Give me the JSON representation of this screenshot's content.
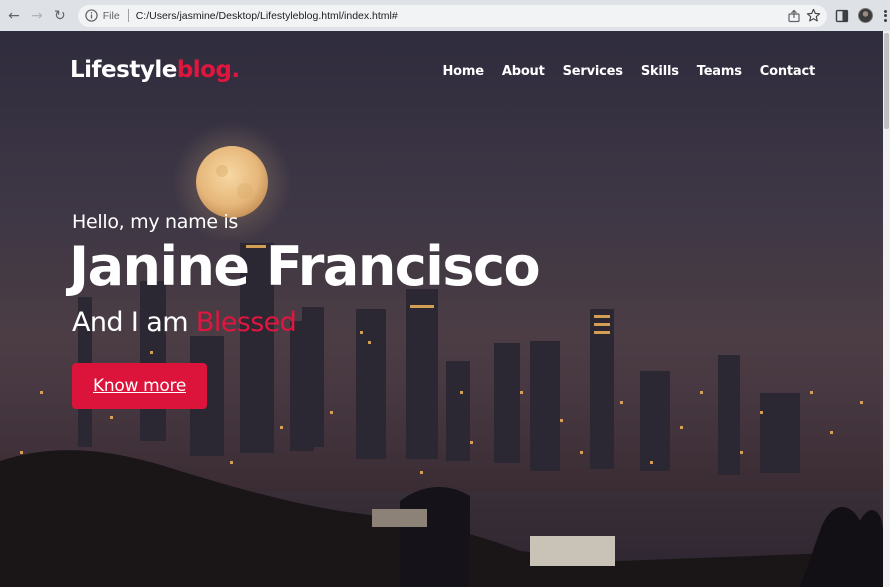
{
  "browser": {
    "scheme": "File",
    "url": "C:/Users/jasmine/Desktop/Lifestyleblog.html/index.html#"
  },
  "site": {
    "logo_main": "Lifestyle",
    "logo_accent": "blog.",
    "accent_color": "#e0163f",
    "nav": [
      "Home",
      "About",
      "Services",
      "Skills",
      "Teams",
      "Contact"
    ]
  },
  "hero": {
    "greeting": "Hello, my name is",
    "name": "Janine Francisco",
    "tagline_prefix": "And I am ",
    "tagline_accent": "Blessed",
    "cta_label": "Know more",
    "background": "night city skyline with full moon"
  }
}
